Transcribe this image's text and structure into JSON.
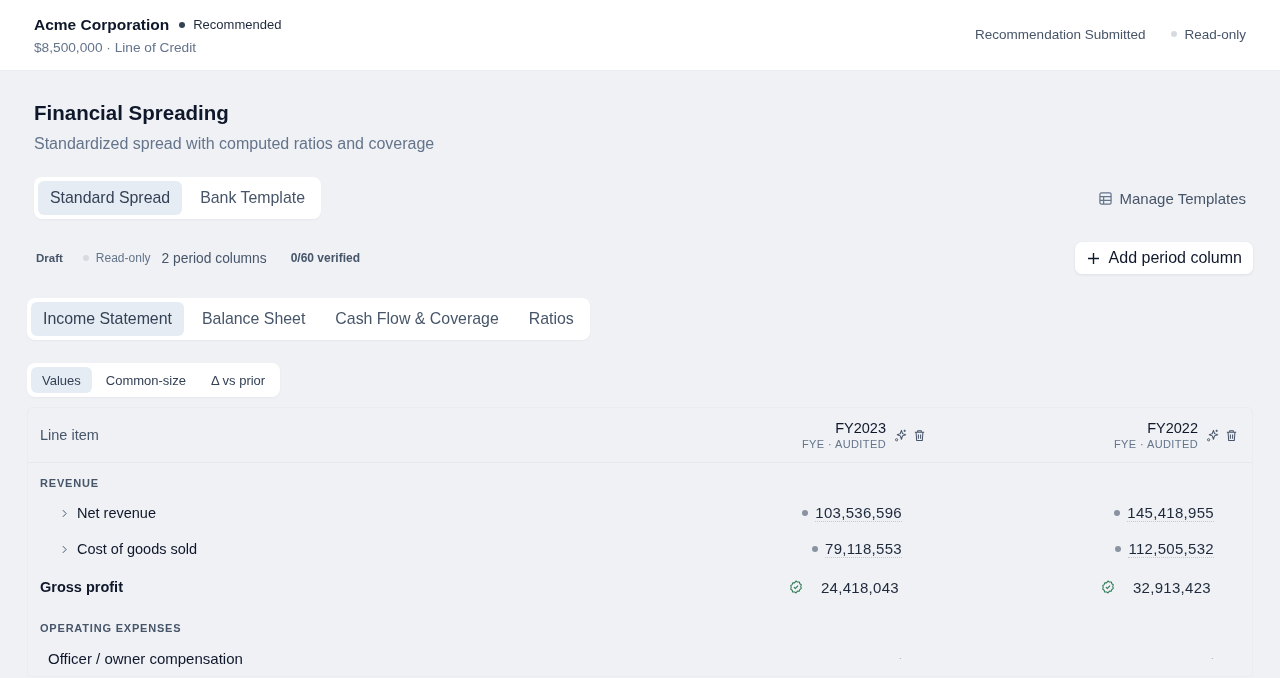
{
  "header": {
    "company": "Acme Corporation",
    "status": "Recommended",
    "loan": "$8,500,000 · Line of Credit",
    "submission": "Recommendation Submitted",
    "access": "Read-only"
  },
  "page": {
    "title": "Financial Spreading",
    "subtitle": "Standardized spread with computed ratios and coverage"
  },
  "template_tabs": [
    {
      "label": "Standard Spread",
      "selected": true
    },
    {
      "label": "Bank Template",
      "selected": false
    }
  ],
  "manage_templates": "Manage Templates",
  "meta": {
    "state": "Draft",
    "access": "Read-only",
    "periods": "2 period columns",
    "verified": "0/60 verified"
  },
  "add_column_button": "Add period column",
  "statement_tabs": [
    {
      "label": "Income Statement",
      "selected": true
    },
    {
      "label": "Balance Sheet",
      "selected": false
    },
    {
      "label": "Cash Flow & Coverage",
      "selected": false
    },
    {
      "label": "Ratios",
      "selected": false
    }
  ],
  "view_tabs": [
    {
      "label": "Values",
      "selected": true
    },
    {
      "label": "Common-size",
      "selected": false
    },
    {
      "label": "Δ vs prior",
      "selected": false
    }
  ],
  "table": {
    "line_item_heading": "Line item",
    "periods": [
      {
        "label": "FY2023",
        "basis": "FYE · AUDITED"
      },
      {
        "label": "FY2022",
        "basis": "FYE · AUDITED"
      }
    ],
    "rows": [
      {
        "kind": "section",
        "label": "REVENUE"
      },
      {
        "kind": "item",
        "label": "Net revenue",
        "expandable": true,
        "values": [
          {
            "text": "103,536,596",
            "kind": "source"
          },
          {
            "text": "145,418,955",
            "kind": "source"
          }
        ]
      },
      {
        "kind": "item",
        "label": "Cost of goods sold",
        "expandable": true,
        "values": [
          {
            "text": "79,118,553",
            "kind": "source"
          },
          {
            "text": "112,505,532",
            "kind": "source"
          }
        ]
      },
      {
        "kind": "total",
        "label": "Gross profit",
        "expandable": false,
        "values": [
          {
            "text": "24,418,043",
            "kind": "computed"
          },
          {
            "text": "32,913,423",
            "kind": "computed"
          }
        ]
      },
      {
        "kind": "section",
        "label": "OPERATING EXPENSES"
      },
      {
        "kind": "item",
        "label": "Officer / owner compensation",
        "expandable": false,
        "values": [
          {
            "text": "·",
            "kind": "empty"
          },
          {
            "text": "·",
            "kind": "empty"
          }
        ]
      }
    ]
  }
}
